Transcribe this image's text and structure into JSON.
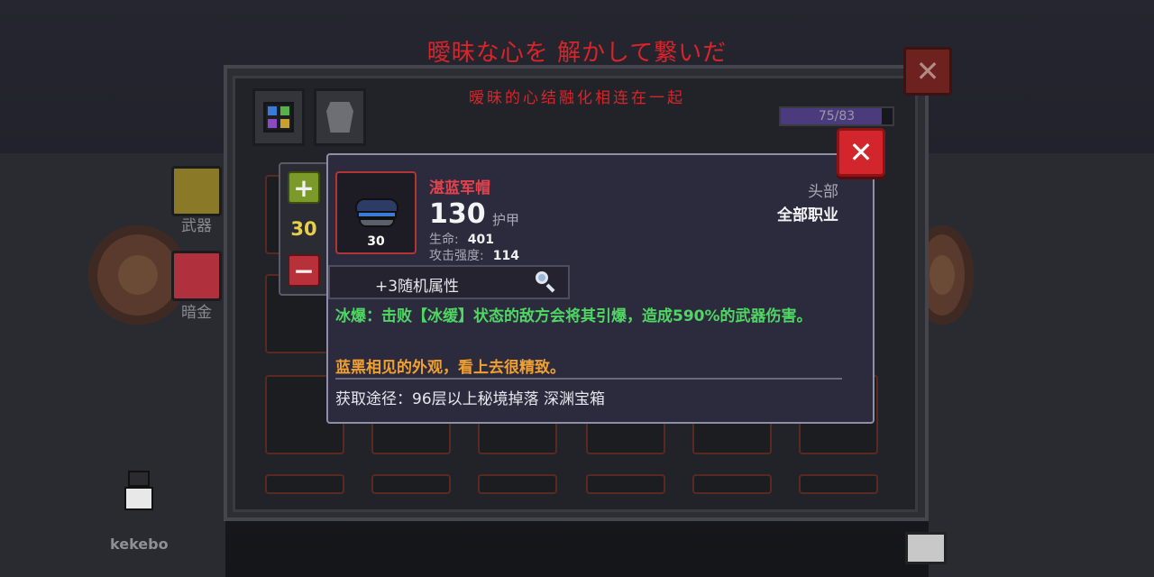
{
  "overlay": {
    "title_jp": "曖昧な心を 解かして繋いだ",
    "title_cn": "暧昧的心结融化相连在一起"
  },
  "inventory": {
    "capacity_text": "75/83",
    "capacity_fraction": 0.9036,
    "categories": [
      "武器",
      "暗金"
    ],
    "npc_name": "kekebo"
  },
  "quantity": {
    "value": "30",
    "plus_label": "+",
    "minus_label": "−"
  },
  "close_label": "✕",
  "item": {
    "name": "湛蓝军帽",
    "level": "30",
    "armor_value": "130",
    "armor_label": "护甲",
    "stats": [
      {
        "label": "生命:",
        "value": "401"
      },
      {
        "label": "攻击强度:",
        "value": "114"
      }
    ],
    "slot": "头部",
    "job": "全部职业",
    "random_attr": "+3随机属性",
    "effect": "冰爆：击败【冰缓】状态的敌方会将其引爆，造成590%的武器伤害。",
    "flavor": "蓝黑相见的外观，看上去很精致。",
    "source": "获取途径：96层以上秘境掉落 深渊宝箱"
  },
  "colors": {
    "title_red": "#d8242a",
    "item_name": "#e2424b",
    "effect_green": "#4fd663",
    "flavor_orange": "#f0a030",
    "close_red": "#d2262c",
    "qty_yellow": "#e7cf4a"
  }
}
